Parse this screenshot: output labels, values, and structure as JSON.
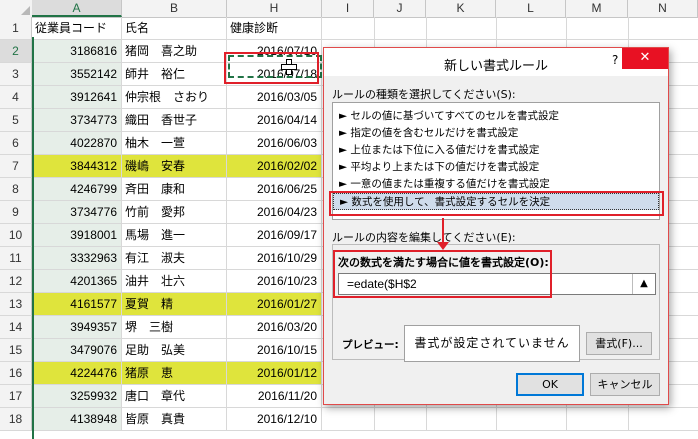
{
  "sheet": {
    "columns": [
      "A",
      "B",
      "H",
      "I",
      "J",
      "K",
      "L",
      "M",
      "N"
    ],
    "header_row": {
      "num": "1",
      "a": "従業員コード",
      "b": "氏名",
      "h": "健康診断"
    },
    "rows": [
      {
        "num": "2",
        "a": "3186816",
        "b": "猪岡　喜之助",
        "h": "2016/07/10",
        "highlight": false
      },
      {
        "num": "3",
        "a": "3552142",
        "b": "師井　裕仁",
        "h": "2016/07/18",
        "highlight": false
      },
      {
        "num": "4",
        "a": "3912641",
        "b": "仲宗根　さおり",
        "h": "2016/03/05",
        "highlight": false
      },
      {
        "num": "5",
        "a": "3734773",
        "b": "織田　香世子",
        "h": "2016/04/14",
        "highlight": false
      },
      {
        "num": "6",
        "a": "4022870",
        "b": "柚木　一萱",
        "h": "2016/06/03",
        "highlight": false
      },
      {
        "num": "7",
        "a": "3844312",
        "b": "磯嶋　安春",
        "h": "2016/02/02",
        "highlight": true
      },
      {
        "num": "8",
        "a": "4246799",
        "b": "斉田　康和",
        "h": "2016/06/25",
        "highlight": false
      },
      {
        "num": "9",
        "a": "3734776",
        "b": "竹前　愛邦",
        "h": "2016/04/23",
        "highlight": false
      },
      {
        "num": "10",
        "a": "3918001",
        "b": "馬場　進一",
        "h": "2016/09/17",
        "highlight": false
      },
      {
        "num": "11",
        "a": "3332963",
        "b": "有江　淑夫",
        "h": "2016/10/29",
        "highlight": false
      },
      {
        "num": "12",
        "a": "4201365",
        "b": "油井　壮六",
        "h": "2016/10/23",
        "highlight": false
      },
      {
        "num": "13",
        "a": "4161577",
        "b": "夏賀　精",
        "h": "2016/01/27",
        "highlight": true
      },
      {
        "num": "14",
        "a": "3949357",
        "b": "堺　三樹",
        "h": "2016/03/20",
        "highlight": false
      },
      {
        "num": "15",
        "a": "3479076",
        "b": "足助　弘美",
        "h": "2016/10/15",
        "highlight": false
      },
      {
        "num": "16",
        "a": "4224476",
        "b": "猪原　恵",
        "h": "2016/01/12",
        "highlight": true
      },
      {
        "num": "17",
        "a": "3259932",
        "b": "唐口　章代",
        "h": "2016/11/20",
        "highlight": false
      },
      {
        "num": "18",
        "a": "4138948",
        "b": "皆原　真貴",
        "h": "2016/12/10",
        "highlight": false
      }
    ]
  },
  "dialog": {
    "title": "新しい書式ルール",
    "help": "?",
    "close": "✕",
    "rule_type_label": "ルールの種類を選択してください(S):",
    "rule_types": [
      "► セルの値に基づいてすべてのセルを書式設定",
      "► 指定の値を含むセルだけを書式設定",
      "► 上位または下位に入る値だけを書式設定",
      "► 平均より上または下の値だけを書式設定",
      "► 一意の値または重複する値だけを書式設定",
      "► 数式を使用して、書式設定するセルを決定"
    ],
    "selected_rule": 5,
    "edit_label": "ルールの内容を編集してください(E):",
    "formula_label": "次の数式を満たす場合に値を書式設定(O):",
    "formula_value": "=edate($H$2",
    "preview_label": "プレビュー:",
    "preview_text": "書式が設定されていません",
    "format_button": "書式(F)...",
    "ok_button": "OK",
    "cancel_button": "キャンセル"
  },
  "colors": {
    "highlight": "#dfe43c",
    "excel_green": "#217346",
    "annotation_red": "#e0202a",
    "close_red": "#e81123"
  }
}
